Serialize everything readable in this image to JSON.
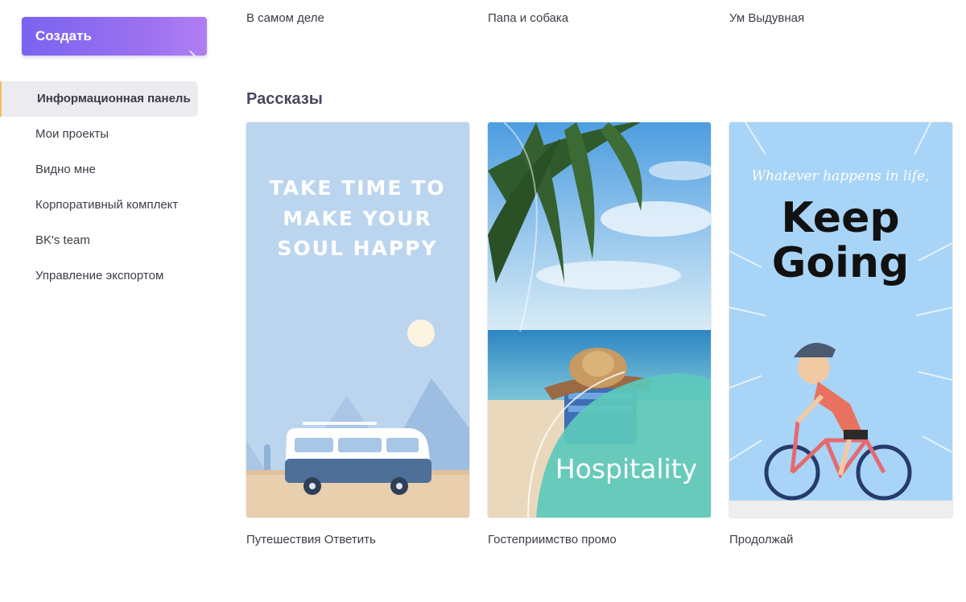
{
  "sidebar": {
    "create_label": "Создать",
    "items": [
      {
        "label": "Информационная панель",
        "active": true
      },
      {
        "label": "Мои проекты"
      },
      {
        "label": "Видно мне"
      },
      {
        "label": "Корпоративный комплект"
      },
      {
        "label": "BK's team"
      },
      {
        "label": "Управление экспортом"
      }
    ]
  },
  "main": {
    "top_row": [
      "В самом деле",
      "Папа и собака",
      "Ум Выдувная"
    ],
    "section_title": "Рассказы",
    "cards": [
      {
        "caption": "Путешествия Ответить",
        "lines": [
          "TAKE TIME TO",
          "MAKE YOUR",
          "SOUL HAPPY"
        ]
      },
      {
        "caption": "Гостеприимство промо",
        "overlay": "Hospitality"
      },
      {
        "caption": "Продолжай",
        "tagline": "Whatever happens in life,",
        "line1": "Keep",
        "line2": "Going"
      }
    ]
  },
  "colors": {
    "accent": "#7a63f0",
    "travel_bg": "#bcd5ef",
    "beach_teal": "#5cc9bb",
    "cycle_bg": "#a8d4f7"
  }
}
